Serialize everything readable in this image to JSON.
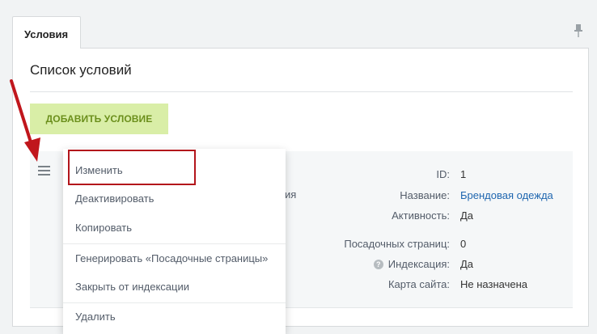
{
  "tab": {
    "label": "Условия"
  },
  "page": {
    "title": "Список условий"
  },
  "toolbar": {
    "add_label": "ДОБАВИТЬ УСЛОВИЕ"
  },
  "condition": {
    "partial_text": "ия",
    "props": [
      {
        "label": "ID:",
        "value": "1"
      },
      {
        "label": "Название:",
        "value": "Брендовая одежда"
      },
      {
        "label": "Активность:",
        "value": "Да"
      },
      {
        "label": "Посадочных страниц:",
        "value": "0"
      },
      {
        "label": "Индексация:",
        "value": "Да"
      },
      {
        "label": "Карта сайта:",
        "value": "Не назначена"
      }
    ]
  },
  "menu": {
    "items": [
      {
        "label": "Изменить"
      },
      {
        "label": "Деактивировать"
      },
      {
        "label": "Копировать"
      },
      {
        "label": "Генерировать «Посадочные страницы»"
      },
      {
        "label": "Закрыть от индексации"
      },
      {
        "label": "Удалить"
      }
    ]
  },
  "colors": {
    "add_button_bg": "#d9eea7",
    "add_button_text": "#6b8f1c",
    "link": "#2067b0",
    "highlight": "#b3151b",
    "arrow": "#c0161c"
  },
  "icons": [
    "pin-icon",
    "hamburger-icon",
    "help-icon",
    "arrow-icon"
  ]
}
